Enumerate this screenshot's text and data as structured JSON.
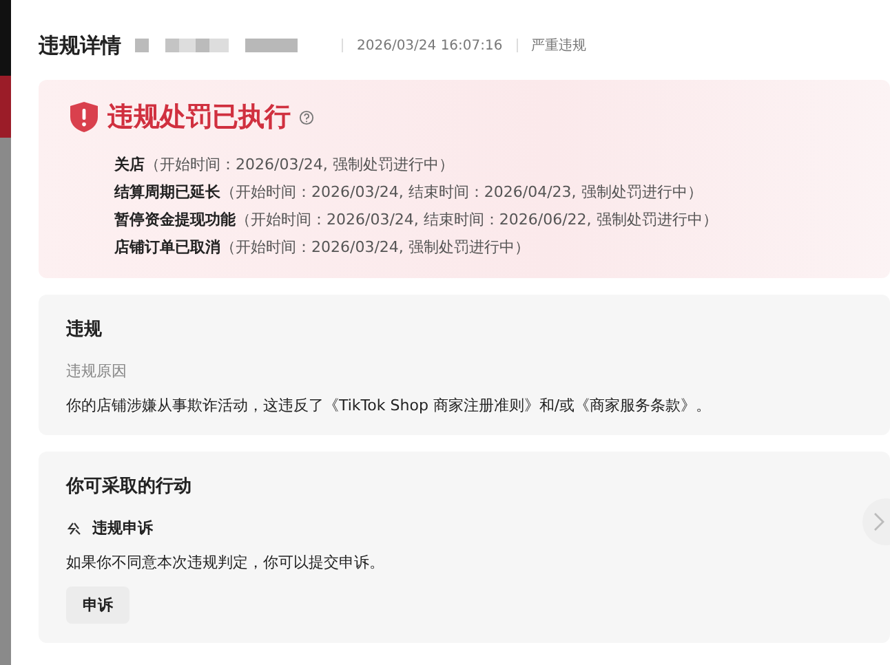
{
  "header": {
    "title": "违规详情",
    "datetime": "2026/03/24 16:07:16",
    "severity": "严重违规"
  },
  "alert": {
    "title": "违规处罚已执行",
    "penalties": [
      {
        "name": "关店",
        "detail": "（开始时间：2026/03/24, 强制处罚进行中）"
      },
      {
        "name": "结算周期已延长",
        "detail": "（开始时间：2026/03/24, 结束时间：2026/04/23, 强制处罚进行中）"
      },
      {
        "name": "暂停资金提现功能",
        "detail": "（开始时间：2026/03/24, 结束时间：2026/06/22, 强制处罚进行中）"
      },
      {
        "name": "店铺订单已取消",
        "detail": "（开始时间：2026/03/24, 强制处罚进行中）"
      }
    ]
  },
  "violation": {
    "title": "违规",
    "reason_label": "违规原因",
    "reason": "你的店铺涉嫌从事欺诈活动，这违反了《TikTok Shop 商家注册准则》和/或《商家服务条款》。"
  },
  "actions": {
    "title": "你可采取的行动",
    "items": [
      {
        "title": "违规申诉",
        "description": "如果你不同意本次违规判定，你可以提交申诉。",
        "button": "申诉"
      }
    ]
  }
}
